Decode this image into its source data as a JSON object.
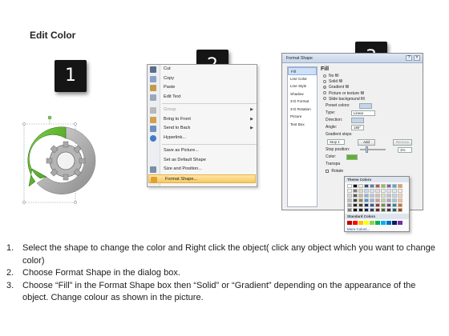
{
  "title": "Edit Color",
  "badges": [
    "1",
    "2",
    "3"
  ],
  "context_menu": {
    "items": [
      {
        "label": "Cut",
        "icon": "scissors-icon",
        "color": "#5a6d8a"
      },
      {
        "label": "Copy",
        "icon": "copy-icon",
        "color": "#8aa3c8"
      },
      {
        "label": "Paste",
        "icon": "paste-icon",
        "color": "#c49a4a"
      },
      {
        "label": "Edit Text",
        "icon": "edit-text-icon",
        "color": "#9aa7b9"
      },
      {
        "label": "Group",
        "icon": "group-icon",
        "color": "#b8b8b8",
        "disabled": true,
        "submenu": true
      },
      {
        "label": "Bring to Front",
        "icon": "bring-front-icon",
        "color": "#d2a04d",
        "submenu": true
      },
      {
        "label": "Send to Back",
        "icon": "send-back-icon",
        "color": "#6f8fbf",
        "submenu": true
      },
      {
        "label": "Hyperlink...",
        "icon": "hyperlink-icon",
        "color": "#3f7ac9"
      },
      {
        "label": "Save as Picture...",
        "icon": "",
        "color": ""
      },
      {
        "label": "Set as Default Shape",
        "icon": "",
        "color": ""
      },
      {
        "label": "Size and Position...",
        "icon": "size-position-icon",
        "color": "#7c8da8"
      },
      {
        "label": "Format Shape...",
        "icon": "format-shape-icon",
        "color": "#e0a030",
        "highlight": true
      }
    ]
  },
  "dialog": {
    "title": "Format Shape",
    "sidebar": [
      "Fill",
      "Line Color",
      "Line Style",
      "Shadow",
      "3-D Format",
      "3-D Rotation",
      "Picture",
      "Text Box"
    ],
    "fill_heading": "Fill",
    "fill_options": [
      {
        "label": "No fill",
        "selected": false
      },
      {
        "label": "Solid fill",
        "selected": false
      },
      {
        "label": "Gradient fill",
        "selected": true
      },
      {
        "label": "Picture or texture fill",
        "selected": false
      },
      {
        "label": "Slide background fill",
        "selected": false
      }
    ],
    "preset_colors_label": "Preset colors:",
    "type_label": "Type:",
    "type_value": "Linear",
    "direction_label": "Direction:",
    "angle_label": "Angle:",
    "angle_value": "180°",
    "gradient_stops_label": "Gradient stops",
    "stop_value": "Stop 1",
    "add_label": "Add",
    "remove_label": "Remove",
    "stop_position_label": "Stop position:",
    "stop_position_value": "1%",
    "color_label": "Color:",
    "transparency_label": "Transpa",
    "rotate_label": "Rotate"
  },
  "palette": {
    "theme_label": "Theme Colors",
    "standard_label": "Standard Colors",
    "more_label": "More Colors...",
    "theme_top": [
      "#ffffff",
      "#000000",
      "#eeece1",
      "#1f497d",
      "#4f81bd",
      "#c0504d",
      "#9bbb59",
      "#8064a2",
      "#4bacc6",
      "#f79646"
    ],
    "theme_shades": [
      [
        "#f2f2f2",
        "#7f7f7f",
        "#ddd9c3",
        "#c6d9f0",
        "#dbe5f1",
        "#f2dcdb",
        "#ebf1dd",
        "#e5e0ec",
        "#dbeef3",
        "#fdeada"
      ],
      [
        "#d8d8d8",
        "#595959",
        "#c4bd97",
        "#8db3e2",
        "#b8cce4",
        "#e5b9b7",
        "#d7e3bc",
        "#ccc1d9",
        "#b7dde8",
        "#fbd5b5"
      ],
      [
        "#bfbfbf",
        "#3f3f3f",
        "#938953",
        "#548dd4",
        "#95b3d7",
        "#d99694",
        "#c3d69b",
        "#b2a2c7",
        "#92cddc",
        "#fac08f"
      ],
      [
        "#a5a5a5",
        "#262626",
        "#494429",
        "#17365d",
        "#366092",
        "#953734",
        "#76923c",
        "#5f497a",
        "#31859b",
        "#e36c09"
      ],
      [
        "#7f7f7f",
        "#0c0c0c",
        "#1d1b10",
        "#0f243e",
        "#244061",
        "#632423",
        "#4f6128",
        "#3f3151",
        "#205867",
        "#974806"
      ]
    ],
    "standard": [
      "#c00000",
      "#ff0000",
      "#ffc000",
      "#ffff00",
      "#92d050",
      "#00b050",
      "#00b0f0",
      "#0070c0",
      "#002060",
      "#7030a0"
    ]
  },
  "instructions": [
    {
      "num": "1.",
      "text": "Select the shape to change the color and Right click the object( click any object which you want to change color)"
    },
    {
      "num": "2.",
      "text": "Choose Format Shape in the dialog box."
    },
    {
      "num": "3.",
      "text": "Choose “Fill” in the Format Shape box then “Solid” or “Gradient” depending on the appearance of the object. Change colour as shown in the picture."
    }
  ],
  "colors": {
    "accent_green": "#5fb329",
    "gear_gray": "#9a9a9a"
  }
}
